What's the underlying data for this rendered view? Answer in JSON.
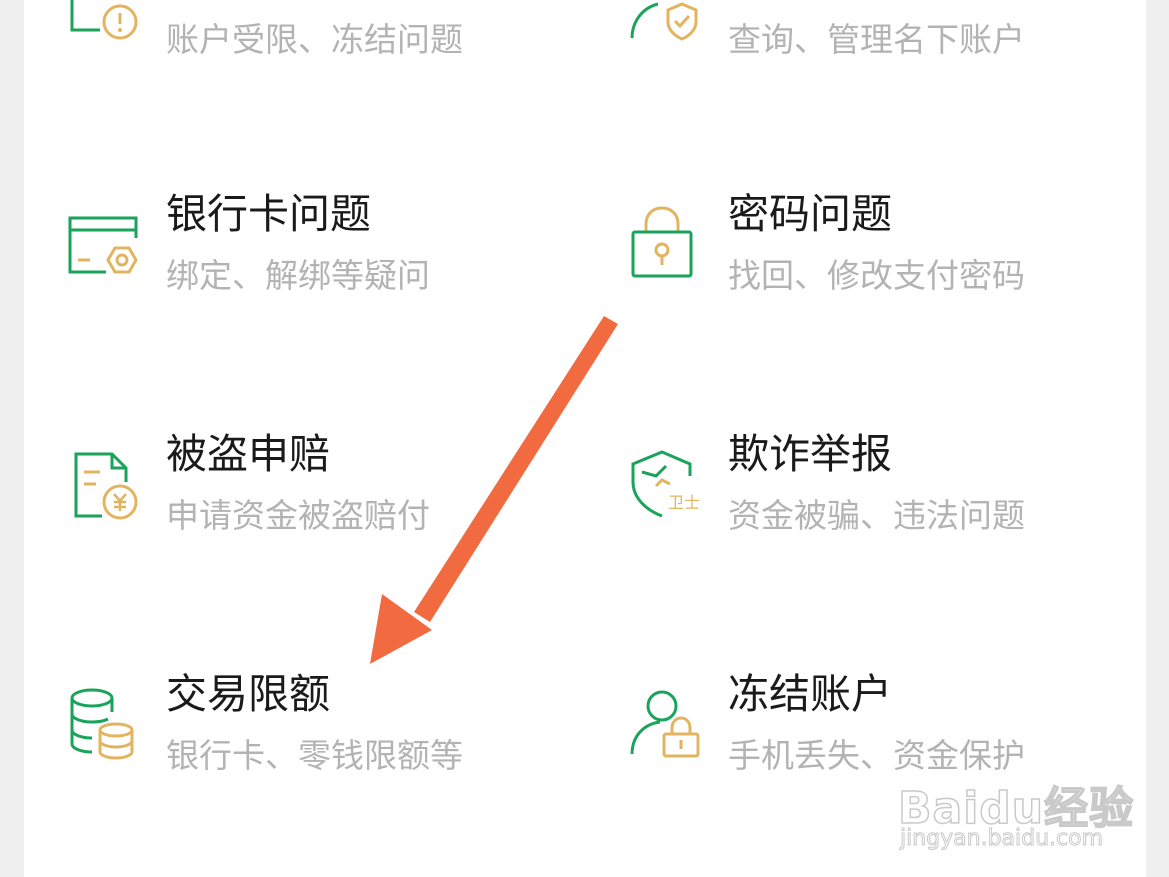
{
  "colors": {
    "green": "#1aa35a",
    "gold": "#e3b45f",
    "arrow": "#f26a3f"
  },
  "items": [
    {
      "title": "",
      "desc": "账户受限、冻结问题",
      "icon": "account-alert-icon"
    },
    {
      "title": "",
      "desc": "查询、管理名下账户",
      "icon": "user-shield-icon"
    },
    {
      "title": "银行卡问题",
      "desc": "绑定、解绑等疑问",
      "icon": "bank-card-icon"
    },
    {
      "title": "密码问题",
      "desc": "找回、修改支付密码",
      "icon": "lock-icon"
    },
    {
      "title": "被盗申赔",
      "desc": "申请资金被盗赔付",
      "icon": "claim-document-icon"
    },
    {
      "title": "欺诈举报",
      "desc": "资金被骗、违法问题",
      "icon": "fraud-shield-icon"
    },
    {
      "title": "交易限额",
      "desc": "银行卡、零钱限额等",
      "icon": "coin-stack-icon"
    },
    {
      "title": "冻结账户",
      "desc": "手机丢失、资金保护",
      "icon": "user-lock-icon"
    }
  ],
  "watermark": {
    "brand": "Baidu经验",
    "url": "jingyan.baidu.com"
  }
}
